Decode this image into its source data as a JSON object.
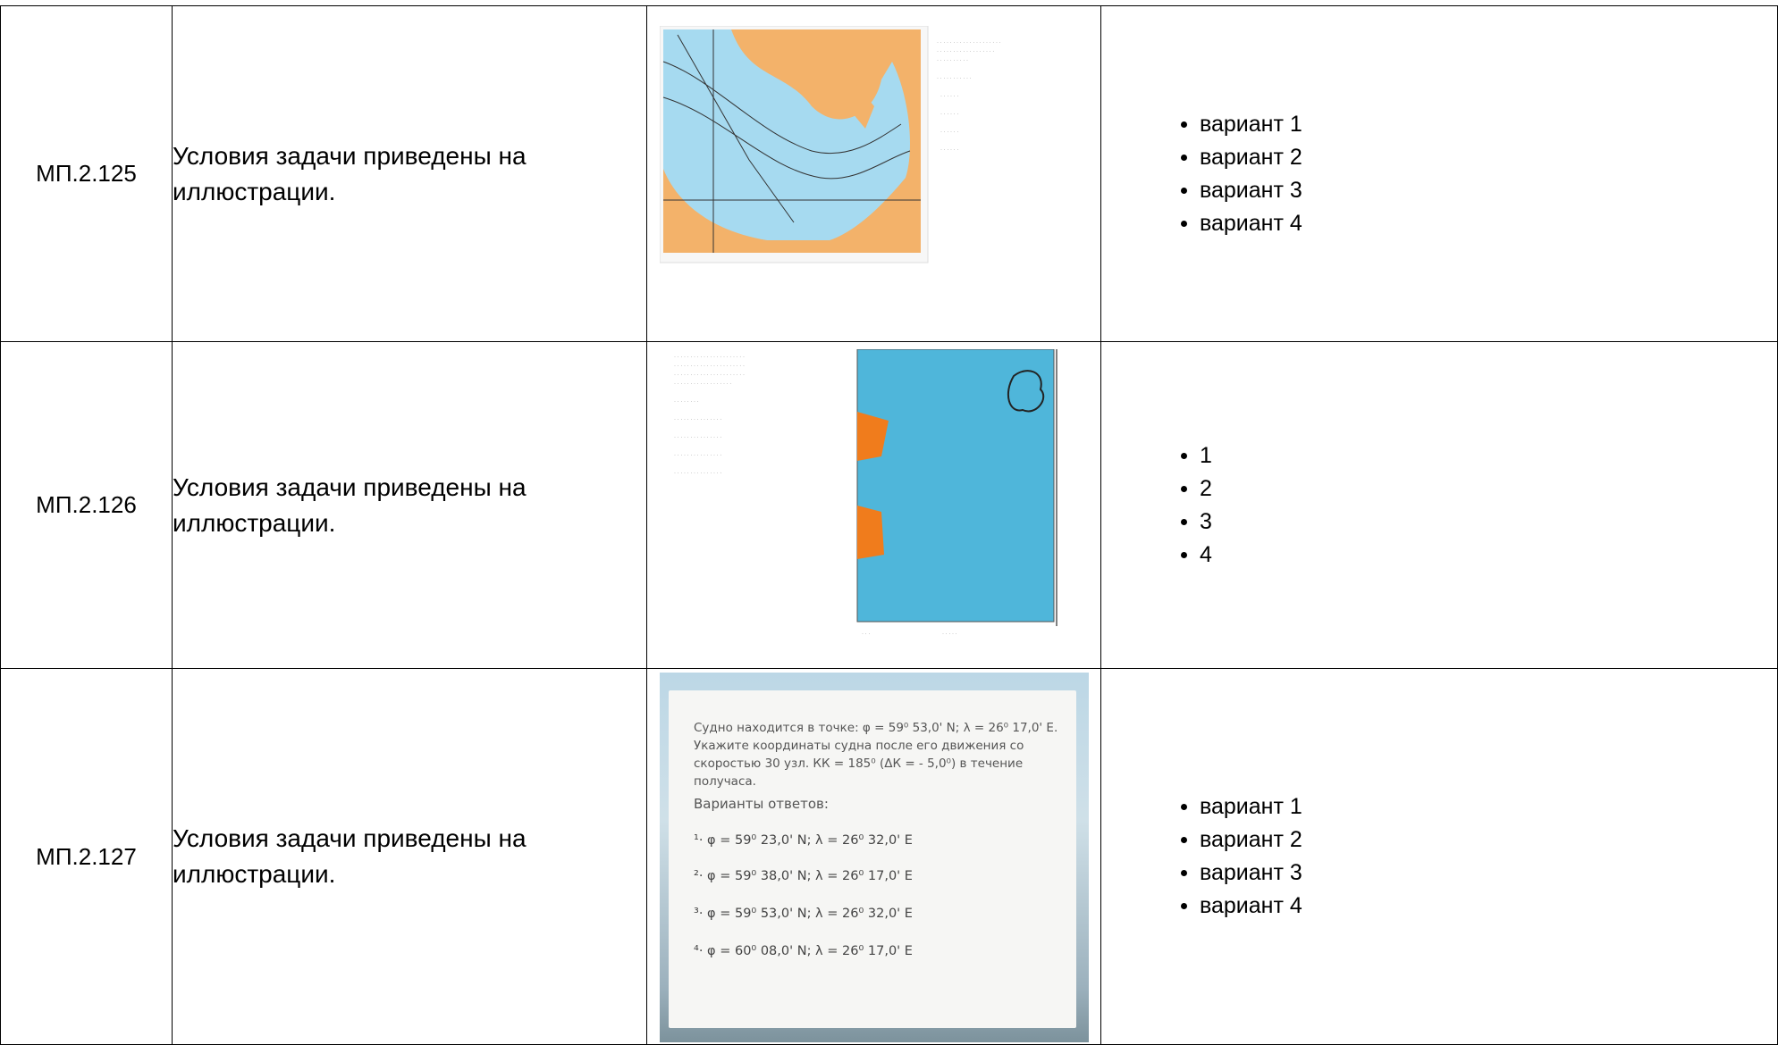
{
  "rows": [
    {
      "id": "МП.2.125",
      "question": "Условия задачи приведены на иллюстрации.",
      "answers": [
        "вариант 1",
        "вариант 2",
        "вариант 3",
        "вариант 4"
      ]
    },
    {
      "id": "МП.2.126",
      "question": "Условия задачи приведены на иллюстрации.",
      "answers": [
        "1",
        "2",
        "3",
        "4"
      ]
    },
    {
      "id": "МП.2.127",
      "question": "Условия задачи приведены на иллюстрации.",
      "answers": [
        "вариант 1",
        "вариант 2",
        "вариант 3",
        "вариант 4"
      ],
      "illustration": {
        "condition": "Судно находится в точке: φ = 59⁰ 53,0' N; λ = 26⁰ 17,0' E. Укажите координаты судна после его движения со скоростью 30 узл. КК = 185⁰ (ΔК = - 5,0⁰) в течение получаса.",
        "options_title": "Варианты ответов:",
        "options": [
          "¹· φ = 59⁰ 23,0' N; λ = 26⁰ 32,0' E",
          "²· φ = 59⁰ 38,0' N; λ = 26⁰ 17,0' E",
          "³· φ = 59⁰ 53,0' N; λ = 26⁰ 32,0' E",
          "⁴· φ = 60⁰ 08,0' N; λ = 26⁰ 17,0' E"
        ]
      }
    }
  ],
  "colors": {
    "sea": "#a6daf0",
    "land": "#f3b26a",
    "sea2": "#4fb6da",
    "shore": "#f07c1c"
  }
}
